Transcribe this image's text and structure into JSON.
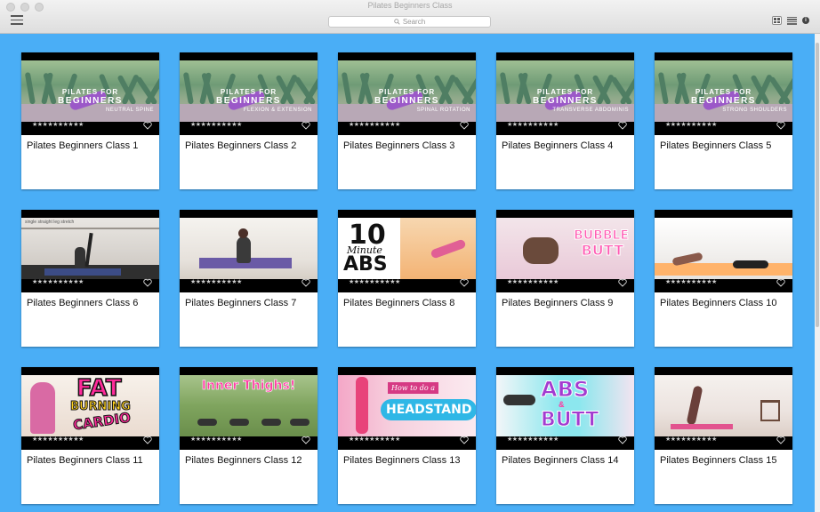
{
  "window": {
    "title": "Pilates Beginners Class"
  },
  "toolbar": {
    "search_placeholder": "Search",
    "menu_icon": "hamburger-icon",
    "grid_view_icon": "grid-view-icon",
    "list_view_icon": "list-view-icon",
    "info_icon": "info-icon"
  },
  "colors": {
    "background": "#4aaef6",
    "card": "#ffffff",
    "thumb_bar": "#000000"
  },
  "videos": [
    {
      "title": "Pilates Beginners Class 1",
      "thumb_text": [
        "PILATES FOR",
        "BEGINNERS",
        "NEUTRAL SPINE"
      ]
    },
    {
      "title": "Pilates Beginners Class 2",
      "thumb_text": [
        "PILATES FOR",
        "BEGINNERS",
        "FLEXION & EXTENSION"
      ]
    },
    {
      "title": "Pilates Beginners Class 3",
      "thumb_text": [
        "PILATES FOR",
        "BEGINNERS",
        "SPINAL ROTATION"
      ]
    },
    {
      "title": "Pilates Beginners Class 4",
      "thumb_text": [
        "PILATES FOR",
        "BEGINNERS",
        "TRANSVERSE ABDOMINIS"
      ]
    },
    {
      "title": "Pilates Beginners Class 5",
      "thumb_text": [
        "PILATES FOR",
        "BEGINNERS",
        "STRONG SHOULDERS"
      ]
    },
    {
      "title": "Pilates Beginners Class 6",
      "thumb_text": [
        "single straight leg stretch"
      ]
    },
    {
      "title": "Pilates Beginners Class 7",
      "thumb_text": []
    },
    {
      "title": "Pilates Beginners Class 8",
      "thumb_text": [
        "10",
        "Minute",
        "ABS"
      ]
    },
    {
      "title": "Pilates Beginners Class 9",
      "thumb_text": [
        "BUBBLE",
        "BUTT"
      ]
    },
    {
      "title": "Pilates Beginners Class 10",
      "thumb_text": []
    },
    {
      "title": "Pilates Beginners Class 11",
      "thumb_text": [
        "FAT",
        "BURNING",
        "CARDIO"
      ]
    },
    {
      "title": "Pilates Beginners Class 12",
      "thumb_text": [
        "Inner Thighs!"
      ]
    },
    {
      "title": "Pilates Beginners Class 13",
      "thumb_text": [
        "How to do a",
        "HEADSTAND"
      ]
    },
    {
      "title": "Pilates Beginners Class 14",
      "thumb_text": [
        "ABS",
        "&",
        "BUTT"
      ]
    },
    {
      "title": "Pilates Beginners Class 15",
      "thumb_text": []
    }
  ],
  "rating_stars": "★★★★★★★★★★",
  "heart_icon": "heart-icon"
}
